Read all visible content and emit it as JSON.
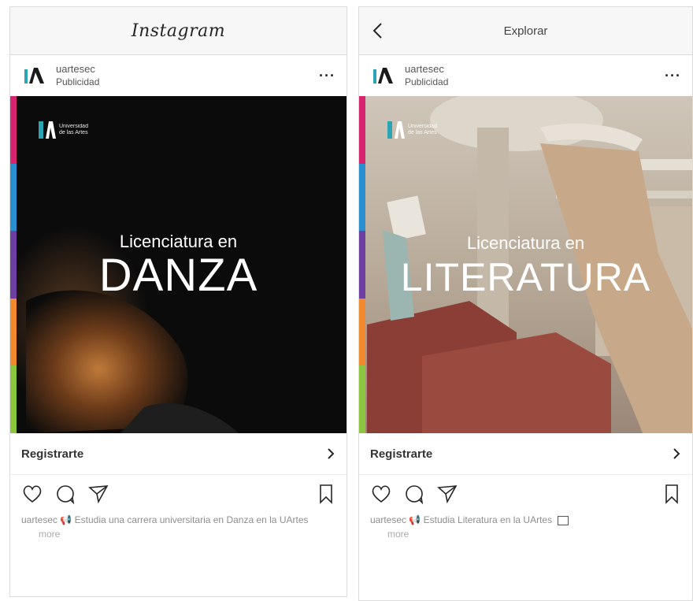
{
  "left": {
    "header_title": "Instagram",
    "username": "uartesec",
    "sponsored": "Publicidad",
    "headline_line1": "Licenciatura en",
    "headline_line2": "DANZA",
    "brand_text_1": "Universidad",
    "brand_text_2": "de las Artes",
    "cta": "Registrarte",
    "caption_user": "uartesec",
    "caption_icon": "megaphone-icon",
    "caption_text": "Estudia una carrera universitaria en Danza en la UArtes",
    "caption_more": "more"
  },
  "right": {
    "header_title": "Explorar",
    "username": "uartesec",
    "sponsored": "Publicidad",
    "headline_line1": "Licenciatura en",
    "headline_line2": "LITERATURA",
    "brand_text_1": "Universidad",
    "brand_text_2": "de las Artes",
    "cta": "Registrarte",
    "caption_user": "uartesec",
    "caption_icon": "megaphone-icon",
    "caption_text": "Estudia Literatura en la UArtes",
    "caption_more": "more"
  },
  "colors": {
    "stripe": [
      "#d6246e",
      "#2a8fce",
      "#6c3fa0",
      "#f18a2e",
      "#8cc63f"
    ],
    "brand_teal": "#2ba5b5",
    "dark_bg": "#0b0b0b"
  }
}
